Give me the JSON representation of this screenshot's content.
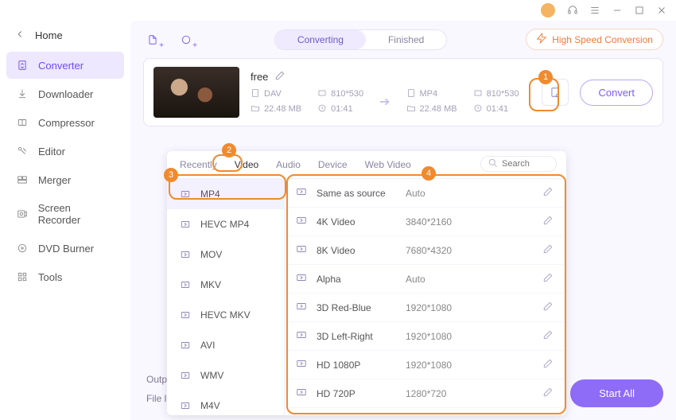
{
  "titlebar": {},
  "back_label": "Home",
  "sidebar": [
    {
      "label": "Converter",
      "active": true,
      "icon": "converter"
    },
    {
      "label": "Downloader",
      "icon": "download"
    },
    {
      "label": "Compressor",
      "icon": "compress"
    },
    {
      "label": "Editor",
      "icon": "editor"
    },
    {
      "label": "Merger",
      "icon": "merger"
    },
    {
      "label": "Screen Recorder",
      "icon": "recorder"
    },
    {
      "label": "DVD Burner",
      "icon": "dvd"
    },
    {
      "label": "Tools",
      "icon": "tools"
    }
  ],
  "tabs": {
    "converting": "Converting",
    "finished": "Finished"
  },
  "hsc_label": "High Speed Conversion",
  "task": {
    "name": "free",
    "src": {
      "format": "DAV",
      "dim": "810*530",
      "size": "22.48 MB",
      "dur": "01:41"
    },
    "dst": {
      "format": "MP4",
      "dim": "810*530",
      "size": "22.48 MB",
      "dur": "01:41"
    },
    "convert_label": "Convert"
  },
  "start_all": "Start All",
  "output_label": "Outp",
  "file_label": "File l",
  "popup": {
    "tabs": [
      "Recently",
      "Video",
      "Audio",
      "Device",
      "Web Video"
    ],
    "tabs_active_index": 1,
    "search_placeholder": "Search",
    "formats": [
      "MP4",
      "HEVC MP4",
      "MOV",
      "MKV",
      "HEVC MKV",
      "AVI",
      "WMV",
      "M4V"
    ],
    "formats_active_index": 0,
    "resolutions": [
      {
        "label": "Same as source",
        "value": "Auto"
      },
      {
        "label": "4K Video",
        "value": "3840*2160"
      },
      {
        "label": "8K Video",
        "value": "7680*4320"
      },
      {
        "label": "Alpha",
        "value": "Auto"
      },
      {
        "label": "3D Red-Blue",
        "value": "1920*1080"
      },
      {
        "label": "3D Left-Right",
        "value": "1920*1080"
      },
      {
        "label": "HD 1080P",
        "value": "1920*1080"
      },
      {
        "label": "HD 720P",
        "value": "1280*720"
      }
    ]
  },
  "callouts": {
    "1": "1",
    "2": "2",
    "3": "3",
    "4": "4"
  }
}
